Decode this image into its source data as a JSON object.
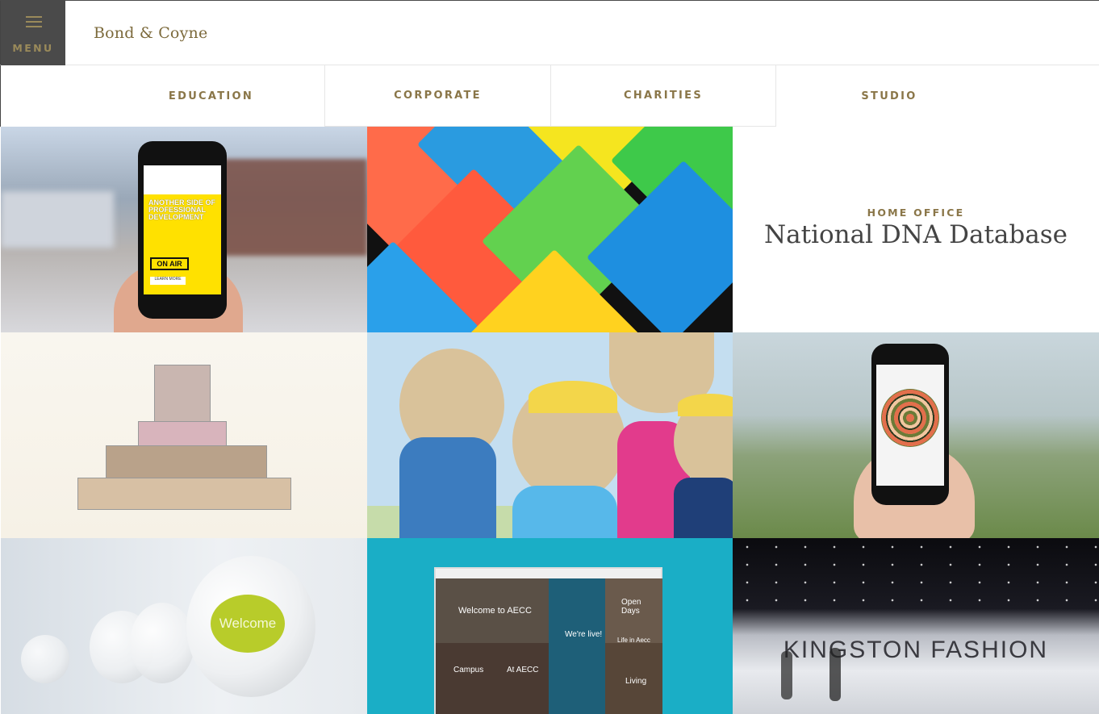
{
  "header": {
    "menu_label": "MENU",
    "brand": "Bond & Coyne"
  },
  "nav": {
    "items": [
      {
        "label": "EDUCATION"
      },
      {
        "label": "CORPORATE"
      },
      {
        "label": "CHARITIES"
      },
      {
        "label": "STUDIO"
      }
    ]
  },
  "grid": {
    "featured": {
      "category": "HOME OFFICE",
      "title": "National DNA Database"
    },
    "tile_text": {
      "phone_headline": "ANOTHER SIDE OF PROFESSIONAL DEVELOPMENT",
      "phone_badge": "ON AIR",
      "phone_button": "LEARN MORE",
      "balloon_word": "Welcome",
      "site_welcome": "Welcome to AECC",
      "site_live": "We're live!",
      "site_open_days": "Open Days",
      "site_campus": "Campus",
      "site_aecc": "At AECC",
      "site_living": "Living",
      "site_life": "Life in Aecc",
      "banner": "KINGSTON FASHION"
    }
  }
}
